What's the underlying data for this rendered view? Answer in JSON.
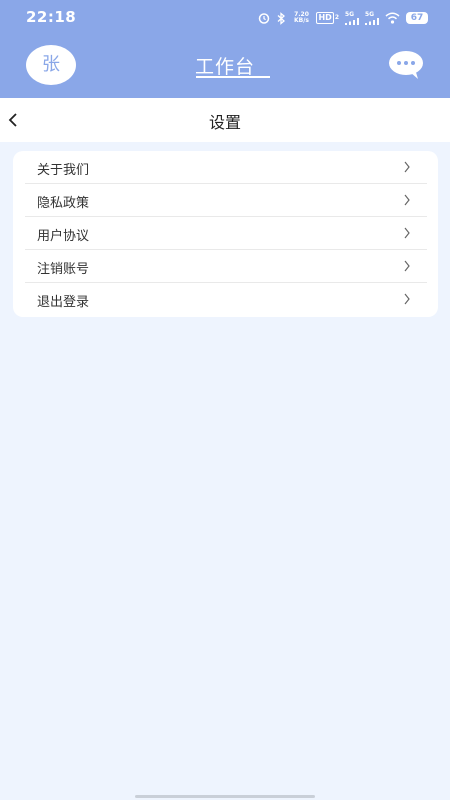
{
  "status_bar": {
    "time": "22:18",
    "net_speed": "7.20\nKB/s",
    "hd_label": "HD",
    "hd_sub": "2",
    "sim1_label": "5G",
    "sim2_label": "5G",
    "battery": "67"
  },
  "header": {
    "avatar_text": "张",
    "title": "工作台"
  },
  "page": {
    "back_icon": "chevron-left-icon",
    "title": "设置"
  },
  "settings": {
    "items": [
      {
        "label": "关于我们"
      },
      {
        "label": "隐私政策"
      },
      {
        "label": "用户协议"
      },
      {
        "label": "注销账号"
      },
      {
        "label": "退出登录"
      }
    ]
  },
  "colors": {
    "accent": "#8aa7e8",
    "background": "#eef4fe"
  }
}
